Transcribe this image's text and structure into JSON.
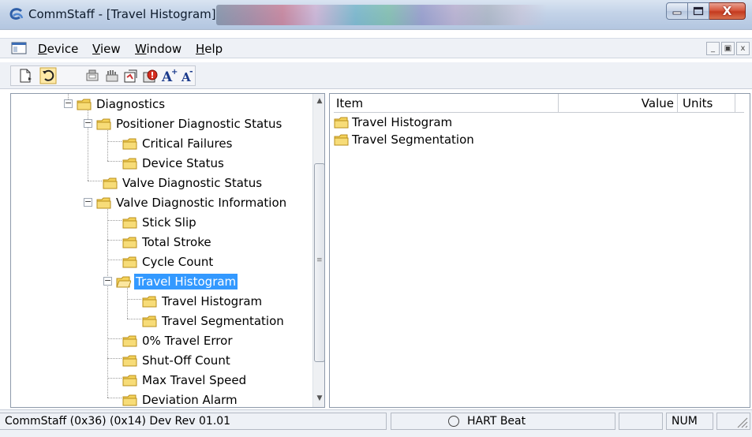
{
  "window": {
    "title": "CommStaff - [Travel Histogram]",
    "app_icon": "commstaff-logo-icon",
    "controls": {
      "minimize": "_",
      "maximize": "□",
      "close": "X"
    }
  },
  "menu": {
    "items": [
      {
        "label": "Device",
        "u": "D",
        "rest": "evice"
      },
      {
        "label": "View",
        "u": "V",
        "rest": "iew"
      },
      {
        "label": "Window",
        "u": "W",
        "rest": "indow"
      },
      {
        "label": "Help",
        "u": "H",
        "rest": "elp"
      }
    ],
    "mdi": {
      "minimize": "_",
      "restore": "▣",
      "close": "x"
    }
  },
  "toolbar": {
    "icons": [
      "new-icon",
      "refresh-icon",
      "device-icon",
      "hand-icon",
      "sync-icon",
      "alert-icon",
      "font-increase-icon",
      "font-decrease-icon"
    ]
  },
  "tree": {
    "nodes": [
      {
        "label": "Diagnostics",
        "level": 0,
        "expander": "−"
      },
      {
        "label": "Positioner Diagnostic Status",
        "level": 1,
        "expander": "−"
      },
      {
        "label": "Critical Failures",
        "level": 2
      },
      {
        "label": "Device Status",
        "level": 2
      },
      {
        "label": "Valve Diagnostic Status",
        "level": 1
      },
      {
        "label": "Valve Diagnostic Information",
        "level": 1,
        "expander": "−"
      },
      {
        "label": "Stick Slip",
        "level": 2
      },
      {
        "label": "Total Stroke",
        "level": 2
      },
      {
        "label": "Cycle Count",
        "level": 2
      },
      {
        "label": "Travel Histogram",
        "level": 2,
        "expander": "−",
        "selected": true,
        "open": true
      },
      {
        "label": "Travel Histogram",
        "level": 3
      },
      {
        "label": "Travel Segmentation",
        "level": 3
      },
      {
        "label": "0% Travel Error",
        "level": 2
      },
      {
        "label": "Shut-Off Count",
        "level": 2
      },
      {
        "label": "Max Travel Speed",
        "level": 2
      },
      {
        "label": "Deviation Alarm",
        "level": 2
      }
    ],
    "scroll_up": "▲",
    "scroll_down": "▼",
    "scroll_grip": "≡"
  },
  "list": {
    "columns": {
      "item": "Item",
      "value": "Value",
      "units": "Units"
    },
    "rows": [
      {
        "item": "Travel Histogram"
      },
      {
        "item": "Travel Segmentation"
      }
    ]
  },
  "status": {
    "device_info": "CommStaff  (0x36)  (0x14) Dev Rev 01.01",
    "hart": "HART Beat",
    "num": "NUM"
  },
  "colors": {
    "folder": "#f4d25a",
    "selection": "#3399ff",
    "close_button": "#c43a1f"
  }
}
